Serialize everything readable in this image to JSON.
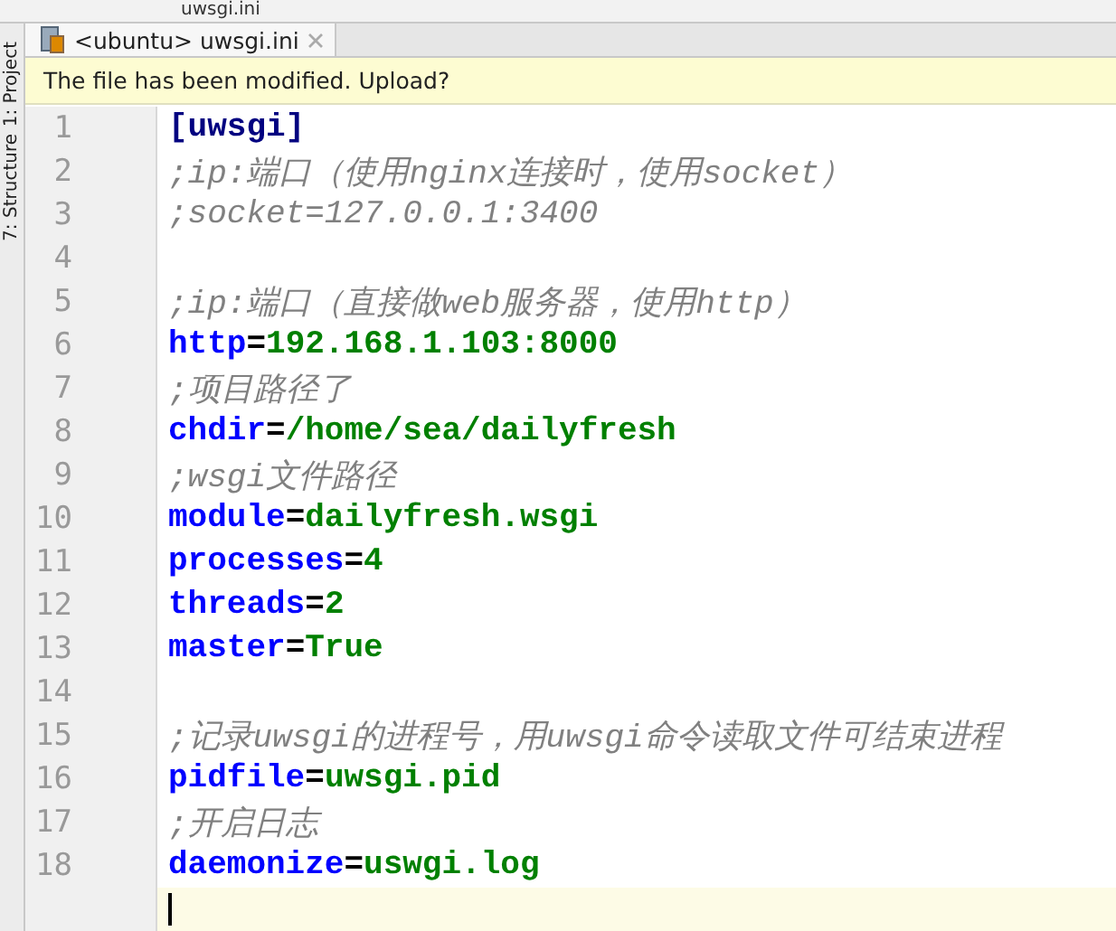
{
  "breadcrumb": {
    "label": "uwsgi.ini"
  },
  "side_tools": [
    {
      "label": "1: Project"
    },
    {
      "label": "7: Structure"
    }
  ],
  "tabs": [
    {
      "label": "<ubuntu> uwsgi.ini",
      "selected": true
    }
  ],
  "notification": {
    "text": "The file has been modified. Upload?"
  },
  "editor": {
    "lines": [
      {
        "number": "1",
        "kind": "section",
        "text": "[uwsgi]"
      },
      {
        "number": "2",
        "kind": "comment",
        "text": ";ip:端口（使用nginx连接时，使用socket）"
      },
      {
        "number": "3",
        "kind": "comment",
        "text": ";socket=127.0.0.1:3400"
      },
      {
        "number": "4",
        "kind": "blank"
      },
      {
        "number": "5",
        "kind": "comment",
        "text": ";ip:端口（直接做web服务器，使用http）"
      },
      {
        "number": "6",
        "kind": "pair",
        "key": "http",
        "sep": "=",
        "value": "192.168.1.103:8000"
      },
      {
        "number": "7",
        "kind": "comment",
        "text": ";项目路径了"
      },
      {
        "number": "8",
        "kind": "pair",
        "key": "chdir",
        "sep": "=",
        "value": "/home/sea/dailyfresh"
      },
      {
        "number": "9",
        "kind": "comment",
        "text": ";wsgi文件路径"
      },
      {
        "number": "10",
        "kind": "pair",
        "key": "module",
        "sep": "=",
        "value": "dailyfresh.wsgi"
      },
      {
        "number": "11",
        "kind": "pair",
        "key": "processes",
        "sep": "=",
        "value": "4"
      },
      {
        "number": "12",
        "kind": "pair",
        "key": "threads",
        "sep": "=",
        "value": "2"
      },
      {
        "number": "13",
        "kind": "pair",
        "key": "master",
        "sep": "=",
        "value": "True"
      },
      {
        "number": "14",
        "kind": "blank"
      },
      {
        "number": "15",
        "kind": "comment",
        "text": ";记录uwsgi的进程号，用uwsgi命令读取文件可结束进程"
      },
      {
        "number": "16",
        "kind": "pair",
        "key": "pidfile",
        "sep": "=",
        "value": "uwsgi.pid"
      },
      {
        "number": "17",
        "kind": "comment",
        "text": ";开启日志"
      },
      {
        "number": "18",
        "kind": "pair",
        "key": "daemonize",
        "sep": "=",
        "value": "uswgi.log"
      }
    ],
    "caret_line": {
      "current": true
    }
  }
}
